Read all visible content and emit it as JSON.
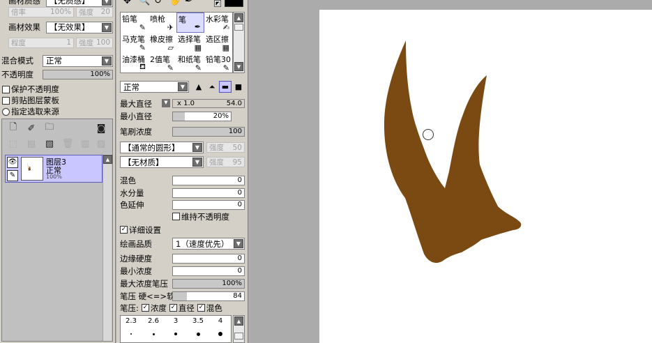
{
  "left_panel": {
    "mode_label_partial": "画材质感",
    "mode_value_partial": "【无质感】",
    "scale_label": "倍率",
    "scale_value": "100%",
    "strength_label": "强度",
    "strength_value_1": "20",
    "effect_label": "画材效果",
    "effect_value": "【无效果】",
    "degree_label": "程度",
    "degree_value": "1",
    "strength_value_2": "100",
    "blend_label": "混合模式",
    "blend_value": "正常",
    "opacity_label": "不透明度",
    "opacity_value": "100%",
    "opacity_fill": 1.0,
    "protect_opacity": "保护不透明度",
    "clip_mask": "剪贴图层蒙板",
    "select_source": "指定选取来源"
  },
  "layer": {
    "name": "图层3",
    "mode": "正常",
    "opacity": "100%"
  },
  "tools_panel": {
    "tools": [
      {
        "name": "铅笔",
        "icon": "✎"
      },
      {
        "name": "喷枪",
        "icon": "✈"
      },
      {
        "name": "笔",
        "icon": "✒"
      },
      {
        "name": "水彩笔",
        "icon": "✍"
      },
      {
        "name": "马克笔",
        "icon": "✎"
      },
      {
        "name": "橡皮擦",
        "icon": "▱"
      },
      {
        "name": "选择笔",
        "icon": "▦"
      },
      {
        "name": "选区擦",
        "icon": "▦"
      },
      {
        "name": "油漆桶",
        "icon": "⛾"
      },
      {
        "name": "2值笔",
        "icon": "✎"
      },
      {
        "name": "和纸笔",
        "icon": "✎"
      },
      {
        "name": "铅笔30",
        "icon": "✎"
      }
    ],
    "brush_mode": "正常",
    "max_size_label": "最大直径",
    "max_size_multiplier": "x 1.0",
    "max_size_value": "54.0",
    "min_size_label": "最小直径",
    "min_size_value": "20%",
    "min_size_fill": 0.2,
    "density_label": "笔刷浓度",
    "density_value": "100",
    "density_fill": 1.0,
    "shape_value": "【通常的圆形】",
    "shape_strength_label": "强度",
    "shape_strength_value": "50",
    "texture_value": "【无材质】",
    "texture_strength_label": "强度",
    "texture_strength_value": "95",
    "blend_label": "混色",
    "blend_value": "0",
    "water_label": "水分量",
    "water_value": "0",
    "stretch_label": "色延伸",
    "stretch_value": "0",
    "keep_opacity": "维持不透明度",
    "detail_settings": "详细设置",
    "quality_label": "绘画品质",
    "quality_value": "1（速度优先）",
    "edge_label": "边缘硬度",
    "edge_value": "0",
    "min_density_label": "最小浓度",
    "min_density_value": "0",
    "max_density_pressure_label": "最大浓度笔压",
    "max_density_pressure_value": "100%",
    "max_density_pressure_fill": 1.0,
    "pressure_label": "笔压 硬<=>软",
    "pressure_value": "84",
    "pressure_fill": 0.2,
    "pressure_toggle_label": "笔压:",
    "pressure_density": "浓度",
    "pressure_size": "直径",
    "pressure_blend": "混色",
    "brush_sizes": [
      "2.3",
      "2.6",
      "3",
      "3.5",
      "4"
    ]
  },
  "colors": {
    "ui_bg": "#d4d0c8",
    "canvas_bg": "#ffffff",
    "workspace_bg": "#ababab",
    "brush_stroke": "#7b4a13",
    "selection": "#c9c6ff"
  }
}
